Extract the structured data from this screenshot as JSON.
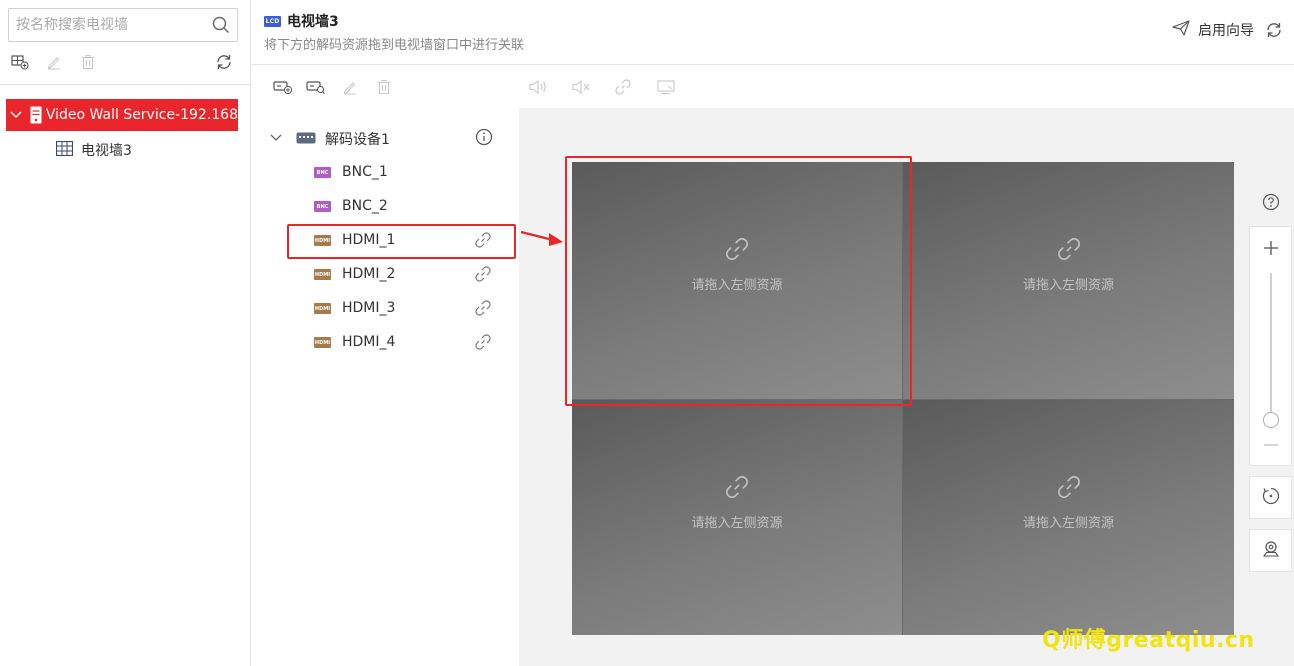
{
  "left_panel": {
    "search": {
      "placeholder": "按名称搜索电视墙",
      "value": ""
    },
    "tree": {
      "root_label": "Video Wall Service-192.168",
      "child_label": "电视墙3"
    }
  },
  "header": {
    "title": "电视墙3",
    "title_icon_text": "LCD",
    "subtitle": "将下方的解码资源拖到电视墙窗口中进行关联",
    "wizard_label": "启用向导"
  },
  "device_tree": {
    "device_label": "解码设备1",
    "channels": [
      {
        "label": "BNC_1",
        "type": "bnc",
        "icon_text": "BNC",
        "linkable": false
      },
      {
        "label": "BNC_2",
        "type": "bnc",
        "icon_text": "BNC",
        "linkable": false
      },
      {
        "label": "HDMI_1",
        "type": "hdmi",
        "icon_text": "HDMI",
        "linkable": true
      },
      {
        "label": "HDMI_2",
        "type": "hdmi",
        "icon_text": "HDMI",
        "linkable": true
      },
      {
        "label": "HDMI_3",
        "type": "hdmi",
        "icon_text": "HDMI",
        "linkable": true
      },
      {
        "label": "HDMI_4",
        "type": "hdmi",
        "icon_text": "HDMI",
        "linkable": true
      }
    ]
  },
  "wall": {
    "screens": [
      {
        "hint": "请拖入左侧资源"
      },
      {
        "hint": "请拖入左侧资源"
      },
      {
        "hint": "请拖入左侧资源"
      },
      {
        "hint": "请拖入左侧资源"
      }
    ]
  },
  "watermark": "Q师傅greatqiu.cn",
  "colors": {
    "accent_red": "#e8262b",
    "lcd_blue": "#3d5fd6",
    "bnc_purple": "#b05dc4",
    "hdmi_brown": "#a77a4c",
    "watermark_yellow": "#f2e312"
  },
  "icons": [
    "search-icon",
    "add-wall-icon",
    "edit-icon",
    "delete-icon",
    "refresh-icon",
    "chevron-down-icon",
    "server-icon",
    "grid-icon",
    "send-icon",
    "add-device-icon",
    "search-device-icon",
    "volume-icon",
    "mute-icon",
    "link-icon",
    "screen-icon",
    "decoder-icon",
    "info-icon",
    "help-icon",
    "zoom-in-icon",
    "zoom-out-icon",
    "rotate-icon",
    "locate-icon"
  ]
}
